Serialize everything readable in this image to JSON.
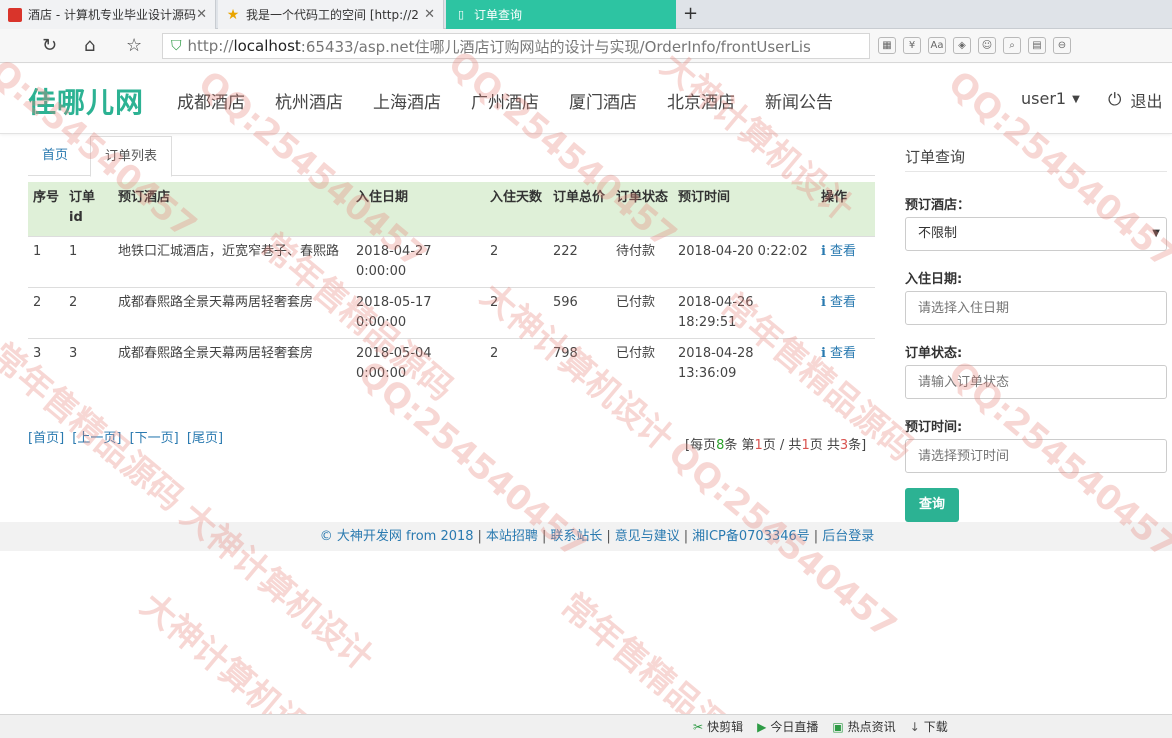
{
  "browser": {
    "tabs": [
      {
        "title": "酒店 - 计算机专业毕业设计源码",
        "favicon": "red-square-icon"
      },
      {
        "title": "我是一个代码工的空间 [http://2",
        "favicon": "star-icon"
      },
      {
        "title": "订单查询",
        "favicon": "page-icon"
      }
    ],
    "new_tab": "+",
    "url_prefix": "http://",
    "url_host": "localhost",
    "url_rest": ":65433/asp.net住哪儿酒店订购网站的设计与实现/OrderInfo/frontUserLis"
  },
  "site": {
    "logo": "佳哪儿网",
    "nav": [
      "成都酒店",
      "杭州酒店",
      "上海酒店",
      "广州酒店",
      "厦门酒店",
      "北京酒店",
      "新闻公告"
    ],
    "user": "user1",
    "logout": "退出",
    "accent": "#2cb293"
  },
  "content_tabs": {
    "home": "首页",
    "active": "订单列表"
  },
  "table": {
    "headers": [
      "序号",
      "订单id",
      "预订酒店",
      "入住日期",
      "入住天数",
      "订单总价",
      "订单状态",
      "预订时间",
      "操作"
    ],
    "rows": [
      {
        "seq": "1",
        "id": "1",
        "hotel": "地铁口汇城酒店，近宽窄巷子、春熙路",
        "checkin": "2018-04-27 0:00:00",
        "days": "2",
        "price": "222",
        "status": "待付款",
        "time": "2018-04-20 0:22:02",
        "action": "查看"
      },
      {
        "seq": "2",
        "id": "2",
        "hotel": "成都春熙路全景天幕两居轻奢套房",
        "checkin": "2018-05-17 0:00:00",
        "days": "2",
        "price": "596",
        "status": "已付款",
        "time": "2018-04-26 18:29:51",
        "action": "查看"
      },
      {
        "seq": "3",
        "id": "3",
        "hotel": "成都春熙路全景天幕两居轻奢套房",
        "checkin": "2018-05-04 0:00:00",
        "days": "2",
        "price": "798",
        "status": "已付款",
        "time": "2018-04-28 13:36:09",
        "action": "查看"
      }
    ]
  },
  "pager": {
    "first": "[首页]",
    "prev": "[上一页]",
    "next": "[下一页]",
    "last": "[尾页]",
    "info_a": "[每页",
    "per_page": "8",
    "info_b": "条 第",
    "current": "1",
    "info_c": "页 / 共",
    "total_pages": "1",
    "info_d": "页 共",
    "total": "3",
    "info_e": "条]"
  },
  "sidebar": {
    "title": "订单查询",
    "hotel_label": "预订酒店：",
    "hotel_value": "不限制",
    "checkin_label": "入住日期:",
    "checkin_placeholder": "请选择入住日期",
    "status_label": "订单状态:",
    "status_placeholder": "请输入订单状态",
    "time_label": "预订时间:",
    "time_placeholder": "请选择预订时间",
    "query_button": "查询"
  },
  "footer": {
    "copyright": "© 大神开发网 from 2018",
    "links": [
      "本站招聘",
      "联系站长",
      "意见与建议",
      "湘ICP备0703346号",
      "后台登录"
    ]
  },
  "statusbar": {
    "items": [
      "快剪辑",
      "今日直播",
      "热点资讯",
      "下载"
    ]
  },
  "watermarks": [
    "QQ:254540457",
    "大神计算机设计",
    "常年售精品源码"
  ]
}
